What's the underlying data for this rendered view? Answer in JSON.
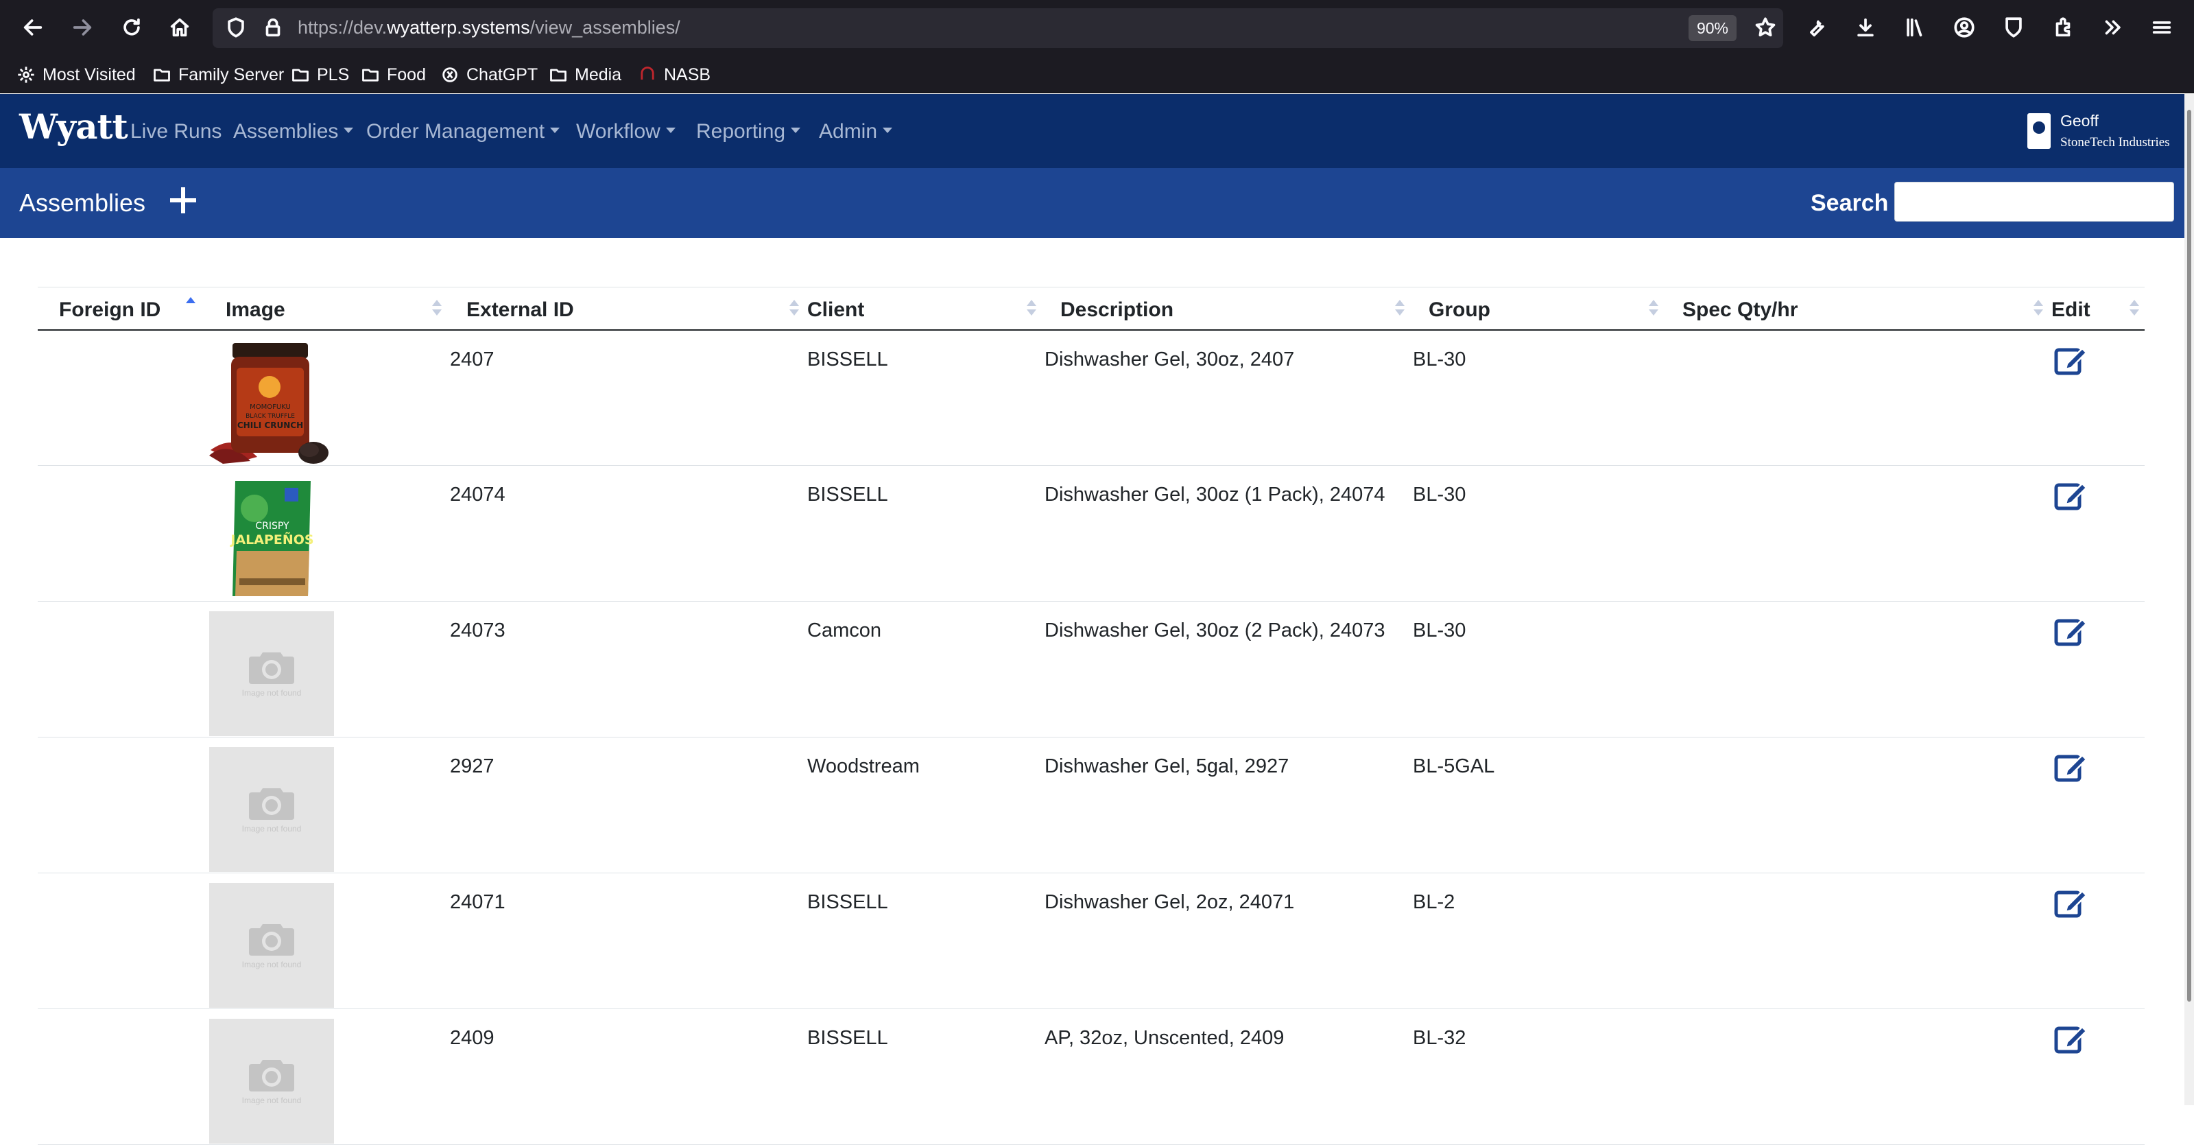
{
  "browser": {
    "url_prefix": "https://dev.",
    "url_host": "wyatterp.systems",
    "url_path": "/view_assemblies/",
    "zoom": "90%",
    "bookmarks": [
      "Most Visited",
      "Family Server",
      "PLS",
      "Food",
      "ChatGPT",
      "Media",
      "NASB"
    ]
  },
  "app": {
    "brand": "Wyatt",
    "nav": [
      "Live Runs",
      "Assemblies",
      "Order Management",
      "Workflow",
      "Reporting",
      "Admin"
    ],
    "user_name": "Geoff",
    "user_company": "StoneTech Industries"
  },
  "subheader": {
    "title": "Assemblies",
    "search_label": "Search",
    "search_value": ""
  },
  "table": {
    "headers": [
      "Foreign ID",
      "Image",
      "External ID",
      "Client",
      "Description",
      "Group",
      "Spec Qty/hr",
      "Edit"
    ],
    "placeholder_text": "Image not found",
    "rows": [
      {
        "foreign_id": "",
        "image": "chili-crunch-jar",
        "external_id": "2407",
        "client": "BISSELL",
        "description": "Dishwasher Gel, 30oz, 2407",
        "group": "BL-30",
        "spec": ""
      },
      {
        "foreign_id": "",
        "image": "crispy-jalapenos-bag",
        "external_id": "24074",
        "client": "BISSELL",
        "description": "Dishwasher Gel, 30oz (1 Pack), 24074",
        "group": "BL-30",
        "spec": ""
      },
      {
        "foreign_id": "",
        "image": "placeholder",
        "external_id": "24073",
        "client": "Camcon",
        "description": "Dishwasher Gel, 30oz (2 Pack), 24073",
        "group": "BL-30",
        "spec": ""
      },
      {
        "foreign_id": "",
        "image": "placeholder",
        "external_id": "2927",
        "client": "Woodstream",
        "description": "Dishwasher Gel, 5gal, 2927",
        "group": "BL-5GAL",
        "spec": ""
      },
      {
        "foreign_id": "",
        "image": "placeholder",
        "external_id": "24071",
        "client": "BISSELL",
        "description": "Dishwasher Gel, 2oz, 24071",
        "group": "BL-2",
        "spec": ""
      },
      {
        "foreign_id": "",
        "image": "placeholder",
        "external_id": "2409",
        "client": "BISSELL",
        "description": "AP, 32oz, Unscented, 2409",
        "group": "BL-32",
        "spec": ""
      }
    ]
  },
  "colors": {
    "navbar": "#0b2d6b",
    "subheader": "#1d4592",
    "edit_icon": "#1d4592"
  }
}
